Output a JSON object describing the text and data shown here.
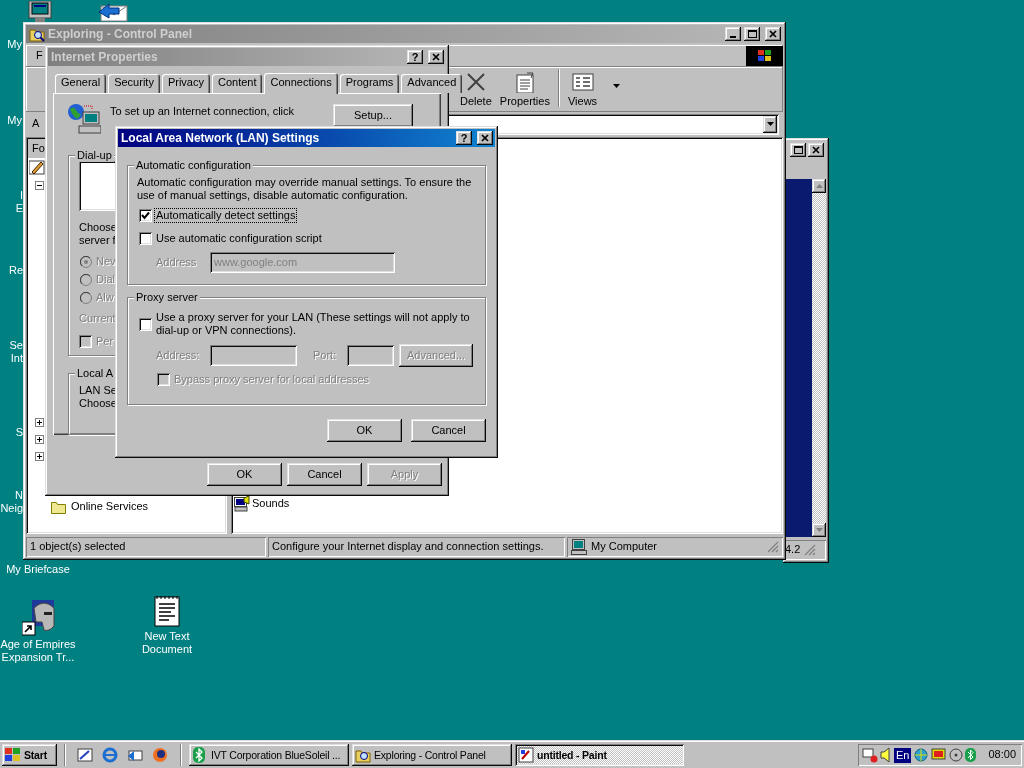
{
  "desktop_icons": [
    {
      "kind": "monitor",
      "lines": [
        "My"
      ]
    },
    {
      "kind": "mail"
    },
    {
      "lines": [
        "My"
      ]
    },
    {
      "lines": [
        "I",
        "E"
      ]
    },
    {
      "lines": [
        "Re"
      ]
    },
    {
      "lines": [
        "Se",
        "Int"
      ]
    },
    {
      "lines": [
        "S"
      ]
    },
    {
      "lines": [
        "N",
        "Neig"
      ]
    },
    {
      "lines": [
        "My Briefcase"
      ]
    },
    {
      "kind": "helmet",
      "lines": [
        "Age of Empires",
        "Expansion Tr..."
      ]
    },
    {
      "kind": "notepad",
      "lines": [
        "New Text",
        "Document"
      ]
    }
  ],
  "back_window": {
    "status": "4.2"
  },
  "explorer": {
    "title": "Exploring - Control Panel",
    "menu": [
      "F"
    ],
    "toolbar": [
      {
        "kind": "delete",
        "label": "Delete"
      },
      {
        "kind": "properties",
        "label": "Properties"
      },
      {
        "kind": "views",
        "label": "Views"
      }
    ],
    "address_label": "A",
    "folders_header": "Fo",
    "tree": [
      {
        "kind": "icon"
      },
      {
        "kind": "toggle",
        "expanded": true
      },
      {
        "kind": "toggle",
        "expanded": false
      },
      {
        "kind": "toggle",
        "expanded": false
      },
      {
        "kind": "toggle",
        "expanded": false
      },
      {
        "kind": "folder",
        "label": "Online Services"
      }
    ],
    "files": [
      {
        "label": "Sounds"
      }
    ],
    "status_bar": [
      "1 object(s) selected",
      "Configure your Internet display and connection settings.",
      "My Computer"
    ]
  },
  "internet_properties": {
    "title": "Internet Properties",
    "help": "?",
    "tabs": [
      {
        "label": "General",
        "selected": false
      },
      {
        "label": "Security",
        "selected": false
      },
      {
        "label": "Privacy",
        "selected": false
      },
      {
        "label": "Content",
        "selected": false
      },
      {
        "label": "Connections",
        "selected": true
      },
      {
        "label": "Programs",
        "selected": false
      },
      {
        "label": "Advanced",
        "selected": false
      }
    ],
    "setup_text": "To set up an Internet connection, click",
    "setup_button": "Setup...",
    "dialup": {
      "legend": "Dial-up",
      "text_lines": [
        "Choose",
        "server f"
      ],
      "radios": [
        {
          "label": "Nev",
          "selected": true,
          "disabled": true
        },
        {
          "label": "Dial",
          "selected": false,
          "disabled": true
        },
        {
          "label": "Alw",
          "selected": false,
          "disabled": true
        }
      ],
      "current": "Current",
      "checkbox": {
        "label": "Per",
        "checked": false,
        "disabled": true
      }
    },
    "lan": {
      "legend": "Local A",
      "lines": [
        "LAN Se",
        "Choose"
      ]
    },
    "buttons": [
      {
        "label": "OK",
        "disabled": false
      },
      {
        "label": "Cancel",
        "disabled": false
      },
      {
        "label": "Apply",
        "disabled": true
      }
    ]
  },
  "lan_dialog": {
    "title": "Local Area Network (LAN) Settings",
    "help": "?",
    "auto": {
      "legend": "Automatic configuration",
      "description": "Automatic configuration may override manual settings.  To ensure the use of manual settings, disable automatic configuration.",
      "options": [
        {
          "label": "Automatically detect settings",
          "checked": true,
          "focused": true
        },
        {
          "label": "Use automatic configuration script",
          "checked": false,
          "focused": false
        }
      ],
      "address_label": "Address",
      "address": {
        "value": "www.google.com",
        "disabled": true
      }
    },
    "proxy": {
      "legend": "Proxy server",
      "option": {
        "label": "Use a proxy server for your LAN (These settings will not apply to dial-up or VPN connections).",
        "checked": false
      },
      "address_label": "Address:",
      "address": {
        "disabled": true
      },
      "port_label": "Port:",
      "port": {
        "disabled": true
      },
      "advanced": {
        "label": "Advanced...",
        "disabled": true
      },
      "bypass": {
        "label": "Bypass proxy server for local addresses",
        "checked": false,
        "disabled": true
      }
    },
    "buttons": [
      {
        "label": "OK"
      },
      {
        "label": "Cancel"
      }
    ]
  },
  "taskbar": {
    "start": "Start",
    "quick_launch": [
      {
        "kind": "desktop"
      },
      {
        "kind": "browser"
      },
      {
        "kind": "outlook"
      },
      {
        "kind": "firefox"
      }
    ],
    "tasks": [
      {
        "kind": "bluetooth",
        "label": "IVT Corporation BlueSoleil ...",
        "selected": false
      },
      {
        "kind": "explorer",
        "label": "Exploring - Control Panel",
        "selected": false
      },
      {
        "kind": "paint",
        "label": "untitled - Paint",
        "selected": true
      }
    ],
    "tray": {
      "language": "En",
      "clock": "08:00"
    }
  }
}
